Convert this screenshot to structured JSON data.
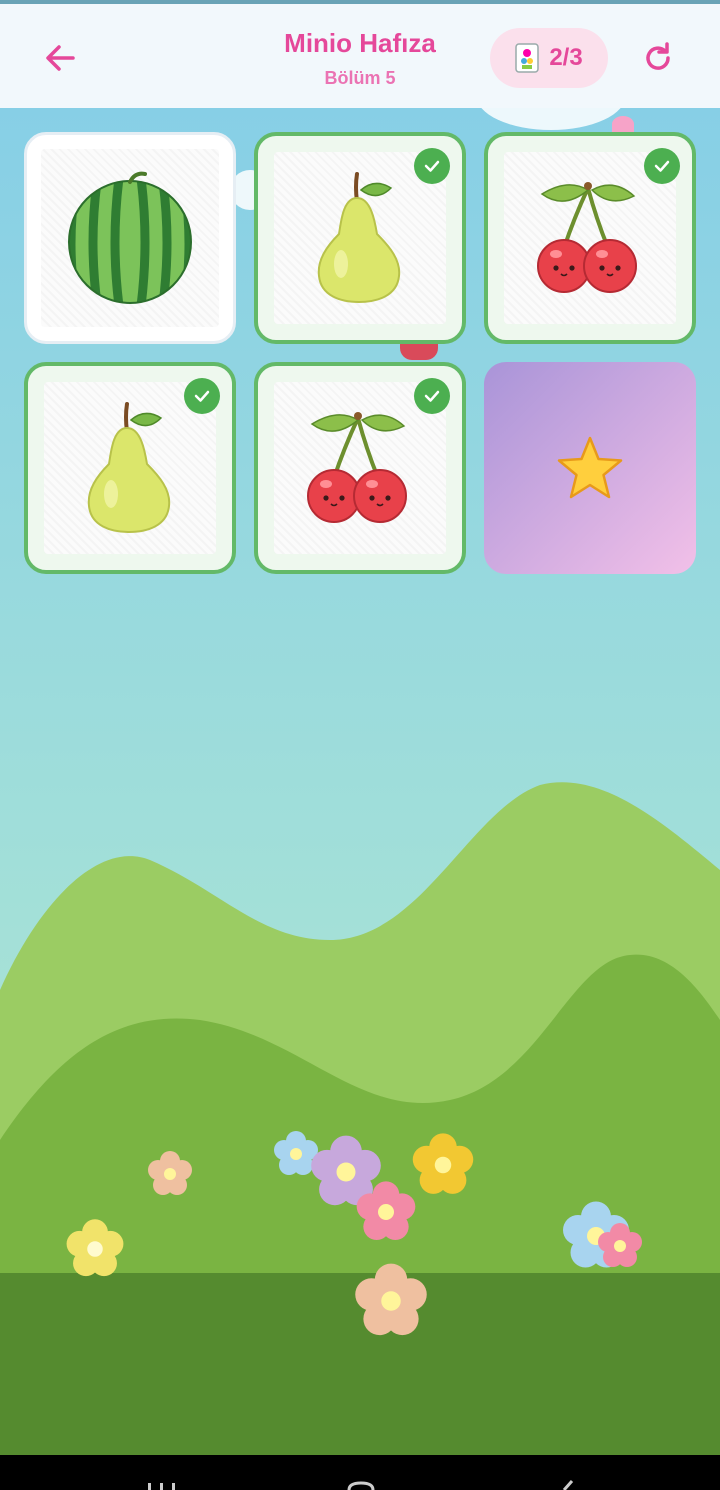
{
  "header": {
    "title": "Minio Hafıza",
    "subtitle": "Bölüm 5",
    "counter": "2/3"
  },
  "cards": [
    {
      "fruit": "watermelon",
      "state": "revealed"
    },
    {
      "fruit": "pear",
      "state": "matched"
    },
    {
      "fruit": "cherry",
      "state": "matched"
    },
    {
      "fruit": "pear",
      "state": "matched"
    },
    {
      "fruit": "cherry",
      "state": "matched"
    },
    {
      "fruit": "star",
      "state": "hidden"
    }
  ],
  "colors": {
    "accent": "#e5489a",
    "matched_border": "#63b968",
    "check": "#4caf50"
  },
  "icons": [
    "back-arrow-icon",
    "cards-icon",
    "restart-icon",
    "check-icon",
    "star-icon"
  ]
}
